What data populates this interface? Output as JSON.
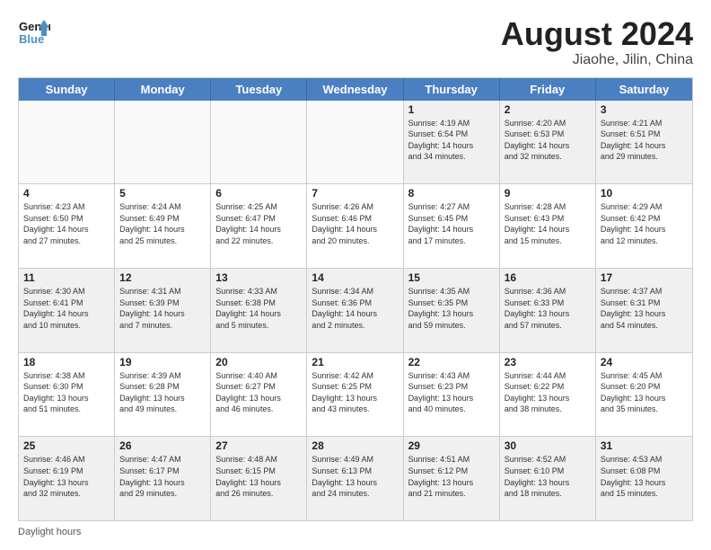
{
  "header": {
    "logo_text_general": "General",
    "logo_text_blue": "Blue",
    "main_title": "August 2024",
    "subtitle": "Jiaohe, Jilin, China"
  },
  "calendar": {
    "days_of_week": [
      "Sunday",
      "Monday",
      "Tuesday",
      "Wednesday",
      "Thursday",
      "Friday",
      "Saturday"
    ],
    "weeks": [
      [
        {
          "day": "",
          "info": "",
          "empty": true
        },
        {
          "day": "",
          "info": "",
          "empty": true
        },
        {
          "day": "",
          "info": "",
          "empty": true
        },
        {
          "day": "",
          "info": "",
          "empty": true
        },
        {
          "day": "1",
          "info": "Sunrise: 4:19 AM\nSunset: 6:54 PM\nDaylight: 14 hours\nand 34 minutes.",
          "empty": false
        },
        {
          "day": "2",
          "info": "Sunrise: 4:20 AM\nSunset: 6:53 PM\nDaylight: 14 hours\nand 32 minutes.",
          "empty": false
        },
        {
          "day": "3",
          "info": "Sunrise: 4:21 AM\nSunset: 6:51 PM\nDaylight: 14 hours\nand 29 minutes.",
          "empty": false
        }
      ],
      [
        {
          "day": "4",
          "info": "Sunrise: 4:23 AM\nSunset: 6:50 PM\nDaylight: 14 hours\nand 27 minutes.",
          "empty": false
        },
        {
          "day": "5",
          "info": "Sunrise: 4:24 AM\nSunset: 6:49 PM\nDaylight: 14 hours\nand 25 minutes.",
          "empty": false
        },
        {
          "day": "6",
          "info": "Sunrise: 4:25 AM\nSunset: 6:47 PM\nDaylight: 14 hours\nand 22 minutes.",
          "empty": false
        },
        {
          "day": "7",
          "info": "Sunrise: 4:26 AM\nSunset: 6:46 PM\nDaylight: 14 hours\nand 20 minutes.",
          "empty": false
        },
        {
          "day": "8",
          "info": "Sunrise: 4:27 AM\nSunset: 6:45 PM\nDaylight: 14 hours\nand 17 minutes.",
          "empty": false
        },
        {
          "day": "9",
          "info": "Sunrise: 4:28 AM\nSunset: 6:43 PM\nDaylight: 14 hours\nand 15 minutes.",
          "empty": false
        },
        {
          "day": "10",
          "info": "Sunrise: 4:29 AM\nSunset: 6:42 PM\nDaylight: 14 hours\nand 12 minutes.",
          "empty": false
        }
      ],
      [
        {
          "day": "11",
          "info": "Sunrise: 4:30 AM\nSunset: 6:41 PM\nDaylight: 14 hours\nand 10 minutes.",
          "empty": false
        },
        {
          "day": "12",
          "info": "Sunrise: 4:31 AM\nSunset: 6:39 PM\nDaylight: 14 hours\nand 7 minutes.",
          "empty": false
        },
        {
          "day": "13",
          "info": "Sunrise: 4:33 AM\nSunset: 6:38 PM\nDaylight: 14 hours\nand 5 minutes.",
          "empty": false
        },
        {
          "day": "14",
          "info": "Sunrise: 4:34 AM\nSunset: 6:36 PM\nDaylight: 14 hours\nand 2 minutes.",
          "empty": false
        },
        {
          "day": "15",
          "info": "Sunrise: 4:35 AM\nSunset: 6:35 PM\nDaylight: 13 hours\nand 59 minutes.",
          "empty": false
        },
        {
          "day": "16",
          "info": "Sunrise: 4:36 AM\nSunset: 6:33 PM\nDaylight: 13 hours\nand 57 minutes.",
          "empty": false
        },
        {
          "day": "17",
          "info": "Sunrise: 4:37 AM\nSunset: 6:31 PM\nDaylight: 13 hours\nand 54 minutes.",
          "empty": false
        }
      ],
      [
        {
          "day": "18",
          "info": "Sunrise: 4:38 AM\nSunset: 6:30 PM\nDaylight: 13 hours\nand 51 minutes.",
          "empty": false
        },
        {
          "day": "19",
          "info": "Sunrise: 4:39 AM\nSunset: 6:28 PM\nDaylight: 13 hours\nand 49 minutes.",
          "empty": false
        },
        {
          "day": "20",
          "info": "Sunrise: 4:40 AM\nSunset: 6:27 PM\nDaylight: 13 hours\nand 46 minutes.",
          "empty": false
        },
        {
          "day": "21",
          "info": "Sunrise: 4:42 AM\nSunset: 6:25 PM\nDaylight: 13 hours\nand 43 minutes.",
          "empty": false
        },
        {
          "day": "22",
          "info": "Sunrise: 4:43 AM\nSunset: 6:23 PM\nDaylight: 13 hours\nand 40 minutes.",
          "empty": false
        },
        {
          "day": "23",
          "info": "Sunrise: 4:44 AM\nSunset: 6:22 PM\nDaylight: 13 hours\nand 38 minutes.",
          "empty": false
        },
        {
          "day": "24",
          "info": "Sunrise: 4:45 AM\nSunset: 6:20 PM\nDaylight: 13 hours\nand 35 minutes.",
          "empty": false
        }
      ],
      [
        {
          "day": "25",
          "info": "Sunrise: 4:46 AM\nSunset: 6:19 PM\nDaylight: 13 hours\nand 32 minutes.",
          "empty": false
        },
        {
          "day": "26",
          "info": "Sunrise: 4:47 AM\nSunset: 6:17 PM\nDaylight: 13 hours\nand 29 minutes.",
          "empty": false
        },
        {
          "day": "27",
          "info": "Sunrise: 4:48 AM\nSunset: 6:15 PM\nDaylight: 13 hours\nand 26 minutes.",
          "empty": false
        },
        {
          "day": "28",
          "info": "Sunrise: 4:49 AM\nSunset: 6:13 PM\nDaylight: 13 hours\nand 24 minutes.",
          "empty": false
        },
        {
          "day": "29",
          "info": "Sunrise: 4:51 AM\nSunset: 6:12 PM\nDaylight: 13 hours\nand 21 minutes.",
          "empty": false
        },
        {
          "day": "30",
          "info": "Sunrise: 4:52 AM\nSunset: 6:10 PM\nDaylight: 13 hours\nand 18 minutes.",
          "empty": false
        },
        {
          "day": "31",
          "info": "Sunrise: 4:53 AM\nSunset: 6:08 PM\nDaylight: 13 hours\nand 15 minutes.",
          "empty": false
        }
      ]
    ]
  },
  "footer": {
    "label": "Daylight hours"
  }
}
